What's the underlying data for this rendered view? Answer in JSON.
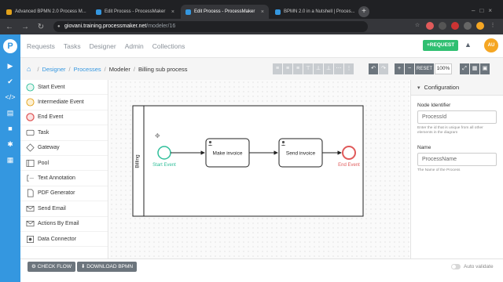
{
  "browser": {
    "tabs": [
      {
        "title": "Advanced BPMN 2.0 Process M...",
        "favicon_color": "#e3a21a",
        "active": false
      },
      {
        "title": "Edit Process - ProcessMaker",
        "favicon_color": "#3497e0",
        "active": false
      },
      {
        "title": "Edit Process - ProcessMaker",
        "favicon_color": "#3497e0",
        "active": true
      },
      {
        "title": "BPMN 2.0 in a Nutshell | Proces...",
        "favicon_color": "#3497e0",
        "active": false
      }
    ],
    "url_host": "giovani.training.processmaker.net",
    "url_path": "/modeler/16"
  },
  "topnav": {
    "items": [
      "Requests",
      "Tasks",
      "Designer",
      "Admin",
      "Collections"
    ],
    "request_button": "+REQUEST",
    "avatar_initials": "AU"
  },
  "breadcrumb": {
    "items": [
      "Designer",
      "Processes",
      "Modeler",
      "Billing sub process"
    ]
  },
  "toolbar": {
    "reset_label": "RESET",
    "zoom_label": "100%"
  },
  "palette": {
    "items": [
      {
        "label": "Start Event",
        "icon": "start-event-icon"
      },
      {
        "label": "Intermediate Event",
        "icon": "intermediate-event-icon"
      },
      {
        "label": "End Event",
        "icon": "end-event-icon"
      },
      {
        "label": "Task",
        "icon": "task-icon"
      },
      {
        "label": "Gateway",
        "icon": "gateway-icon"
      },
      {
        "label": "Pool",
        "icon": "pool-icon"
      },
      {
        "label": "Text Annotation",
        "icon": "text-annotation-icon"
      },
      {
        "label": "PDF Generator",
        "icon": "pdf-generator-icon"
      },
      {
        "label": "Send Email",
        "icon": "send-email-icon"
      },
      {
        "label": "Actions By Email",
        "icon": "actions-by-email-icon"
      },
      {
        "label": "Data Connector",
        "icon": "data-connector-icon"
      }
    ]
  },
  "diagram": {
    "pool_label": "Billing",
    "start_event_label": "Start Event",
    "task1_label": "Make invoice",
    "task2_label": "Send invoice",
    "end_event_label": "End Event",
    "colors": {
      "start": "#2fbf9a",
      "end": "#e05a5a"
    }
  },
  "config": {
    "title": "Configuration",
    "node_identifier_label": "Node Identifier",
    "node_identifier_value": "ProcessId",
    "node_identifier_help": "Enter the id that is unique from all other elements in the diagram",
    "name_label": "Name",
    "name_value": "ProcessName",
    "name_help": "The Name of the Process"
  },
  "footer": {
    "check_flow": "CHECK FLOW",
    "download": "DOWNLOAD BPMN",
    "auto_validate": "Auto validate"
  },
  "accent_color": "#3497e0"
}
